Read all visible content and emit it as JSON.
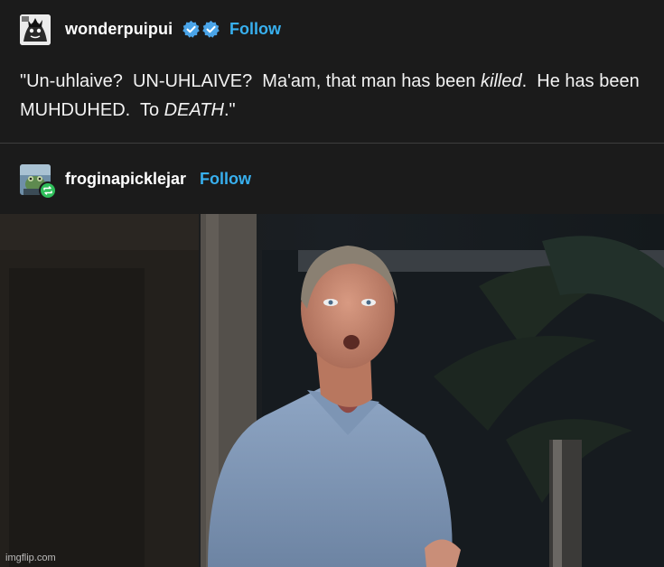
{
  "post": {
    "username": "wonderpuipui",
    "follow_label": "Follow",
    "text_part1": "\"Un-uhlaive?  UN-UHLAIVE?  Ma'am, that man has been ",
    "text_killed": "killed",
    "text_part2": ".  He has been MUHDUHED.  To ",
    "text_death": "DEATH",
    "text_part3": ".\""
  },
  "reblog": {
    "username": "froginapicklejar",
    "follow_label": "Follow"
  },
  "image": {
    "watermark": "imgflip.com"
  },
  "colors": {
    "background": "#1b1b1b",
    "follow_link": "#38b0ef",
    "verified_badge": "#4aa4e8",
    "reblog_badge": "#2fbf5a",
    "divider": "#3e3e3e"
  },
  "icons": [
    "verified-badge-icon",
    "verified-badge-icon",
    "reblog-icon"
  ]
}
